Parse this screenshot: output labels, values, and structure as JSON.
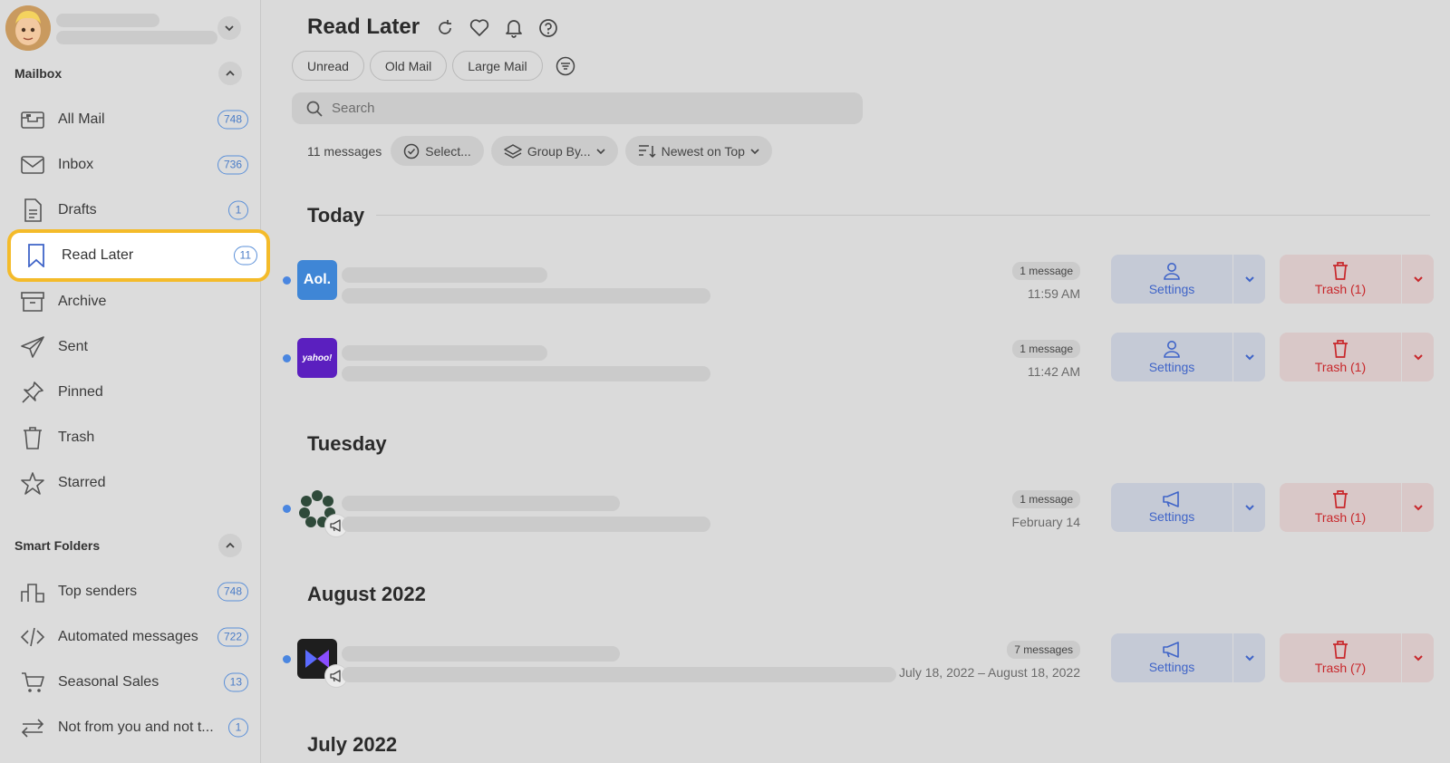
{
  "sidebar": {
    "mailbox_title": "Mailbox",
    "smart_title": "Smart Folders",
    "mailbox_items": [
      {
        "label": "All Mail",
        "count": "748",
        "icon": "all-mail-icon"
      },
      {
        "label": "Inbox",
        "count": "736",
        "icon": "inbox-icon"
      },
      {
        "label": "Drafts",
        "count": "1",
        "icon": "drafts-icon"
      },
      {
        "label": "Read Later",
        "count": "11",
        "icon": "bookmark-icon"
      },
      {
        "label": "Archive",
        "count": "",
        "icon": "archive-icon"
      },
      {
        "label": "Sent",
        "count": "",
        "icon": "sent-icon"
      },
      {
        "label": "Pinned",
        "count": "",
        "icon": "pin-icon"
      },
      {
        "label": "Trash",
        "count": "",
        "icon": "trash-icon"
      },
      {
        "label": "Starred",
        "count": "",
        "icon": "star-icon"
      }
    ],
    "smart_items": [
      {
        "label": "Top senders",
        "count": "748",
        "icon": "top-senders-icon"
      },
      {
        "label": "Automated messages",
        "count": "722",
        "icon": "code-icon"
      },
      {
        "label": "Seasonal Sales",
        "count": "13",
        "icon": "cart-icon"
      },
      {
        "label": "Not from you and not t...",
        "count": "1",
        "icon": "swap-icon"
      }
    ]
  },
  "main": {
    "title": "Read Later",
    "chips": [
      "Unread",
      "Old Mail",
      "Large Mail"
    ],
    "search_placeholder": "Search",
    "message_count": "11 messages",
    "select_label": "Select...",
    "group_by_label": "Group By...",
    "sort_label": "Newest on Top",
    "groups": [
      "Today",
      "Tuesday",
      "August 2022",
      "July 2022"
    ],
    "rows": [
      {
        "logo": "Aol.",
        "count": "1 message",
        "date": "11:59 AM",
        "settings": "Settings",
        "trash": "Trash (1)",
        "settings_icon": "person-icon"
      },
      {
        "logo": "yahoo!",
        "count": "1 message",
        "date": "11:42 AM",
        "settings": "Settings",
        "trash": "Trash (1)",
        "settings_icon": "person-icon"
      },
      {
        "logo": "",
        "count": "1 message",
        "date": "February 14",
        "settings": "Settings",
        "trash": "Trash (1)",
        "settings_icon": "megaphone-icon"
      },
      {
        "logo": "",
        "count": "7 messages",
        "date": "July 18, 2022 – August 18, 2022",
        "settings": "Settings",
        "trash": "Trash (7)",
        "settings_icon": "megaphone-icon"
      }
    ]
  },
  "colors": {
    "accent": "#4a7cc7",
    "highlight": "#f4bb2a",
    "trash_red": "#c8272b",
    "settings_blue": "#3f64c8"
  }
}
